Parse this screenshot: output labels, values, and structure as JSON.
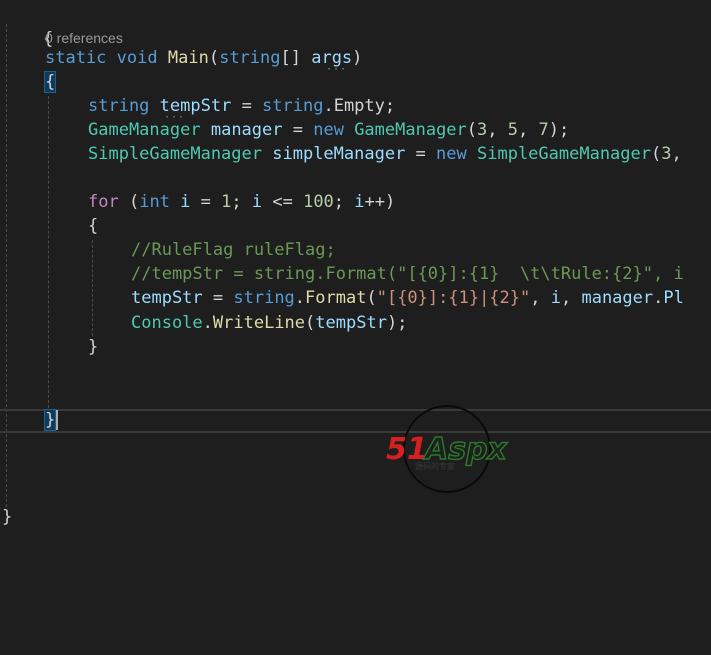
{
  "codelens": {
    "references": "0 references"
  },
  "code": {
    "l0": "{",
    "main_static": "static",
    "main_void": "void",
    "main_name": "Main",
    "main_open": "(",
    "main_string": "string",
    "main_brackets": "[] ",
    "main_args": "args",
    "main_close": ")",
    "brace_open": "{",
    "l1_type": "string",
    "l1_var": "tempStr",
    "l1_eq": " = ",
    "l1_kw": "string",
    "l1_rest": ".Empty;",
    "l2_type": "GameManager",
    "l2_var": "manager",
    "l2_eq": " = ",
    "l2_new": "new",
    "l2_type2": "GameManager",
    "l2_open": "(",
    "l2_n1": "3",
    "l2_c1": ", ",
    "l2_n2": "5",
    "l2_c2": ", ",
    "l2_n3": "7",
    "l2_end": ");",
    "l3_type": "SimpleGameManager",
    "l3_var": "simpleManager",
    "l3_eq": " = ",
    "l3_new": "new",
    "l3_type2": "SimpleGameManager",
    "l3_open": "(",
    "l3_n1": "3",
    "l3_c1": ",",
    "for_kw": "for",
    "for_open": " (",
    "for_int": "int",
    "for_i": "i",
    "for_eq": " = ",
    "for_n1": "1",
    "for_semi1": "; ",
    "for_i2": "i",
    "for_le": " <= ",
    "for_n2": "100",
    "for_semi2": "; ",
    "for_i3": "i",
    "for_end": "++)",
    "for_brace_open": "{",
    "c1": "//RuleFlag ruleFlag;",
    "c2": "//tempStr = string.Format(\"[{0}]:{1}  \\t\\tRule:{2}\", i",
    "l6_var": "tempStr",
    "l6_eq": " = ",
    "l6_kw": "string",
    "l6_dot": ".",
    "l6_fn": "Format",
    "l6_open": "(",
    "l6_str": "\"[{0}]:{1}|{2}\"",
    "l6_c1": ", ",
    "l6_i": "i",
    "l6_c2": ", ",
    "l6_mgr": "manager",
    "l6_dot2": ".",
    "l6_tail": "Pl",
    "l7_type": "Console",
    "l7_dot": ".",
    "l7_fn": "WriteLine",
    "l7_open": "(",
    "l7_var": "tempStr",
    "l7_end": ");",
    "for_brace_close": "}",
    "brace_close": "}",
    "class_close": "}"
  },
  "watermark": {
    "brand_51": "51",
    "brand_aspx": "Aspx",
    "tagline": "源码的专家"
  },
  "colors": {
    "background": "#1e1e1e",
    "keyword": "#569cd6",
    "type": "#4ec9b0",
    "function": "#dcdcaa",
    "variable": "#9cdcfe",
    "number": "#b5cea8",
    "string": "#ce9178",
    "comment": "#6a9955",
    "control": "#c586c0"
  }
}
